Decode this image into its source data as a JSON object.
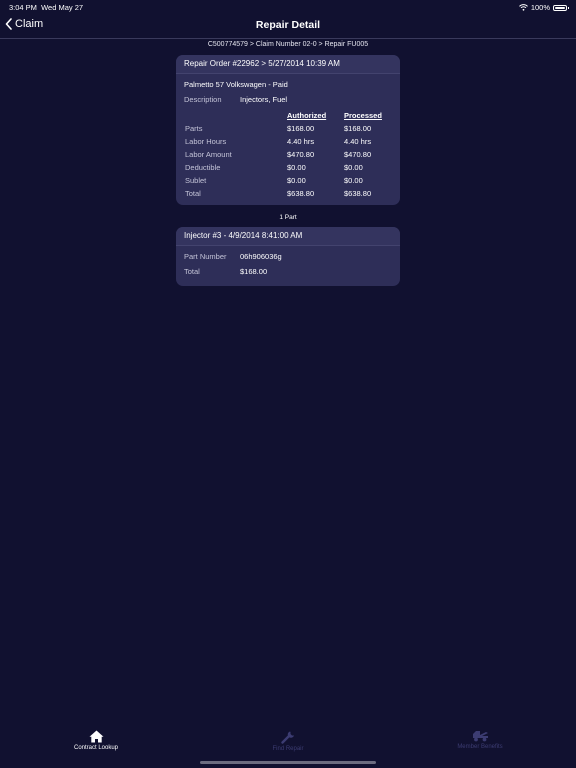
{
  "status_bar": {
    "time": "3:04 PM",
    "date": "Wed May 27",
    "battery": "100%",
    "wifi_icon": "wifi-icon",
    "battery_icon": "battery-icon"
  },
  "nav": {
    "back_label": "Claim",
    "back_icon": "chevron-left-icon",
    "title": "Repair Detail"
  },
  "breadcrumb": "C500774579 > Claim Number 02-0 > Repair FU005",
  "repair_order": {
    "header": "Repair Order #22962 > 5/27/2014 10:39 AM",
    "vehicle": "Palmetto 57 Volkswagen - Paid",
    "description_label": "Description",
    "description_value": "Injectors, Fuel",
    "columns": {
      "authorized": "Authorized",
      "processed": "Processed"
    },
    "rows": [
      {
        "label": "Parts",
        "authorized": "$168.00",
        "processed": "$168.00"
      },
      {
        "label": "Labor Hours",
        "authorized": "4.40 hrs",
        "processed": "4.40 hrs"
      },
      {
        "label": "Labor Amount",
        "authorized": "$470.80",
        "processed": "$470.80"
      },
      {
        "label": "Deductible",
        "authorized": "$0.00",
        "processed": "$0.00"
      },
      {
        "label": "Sublet",
        "authorized": "$0.00",
        "processed": "$0.00"
      },
      {
        "label": "Total",
        "authorized": "$638.80",
        "processed": "$638.80"
      }
    ]
  },
  "parts_count": "1 Part",
  "part": {
    "header": "Injector #3 - 4/9/2014 8:41:00 AM",
    "part_number_label": "Part Number",
    "part_number_value": "06h906036g",
    "total_label": "Total",
    "total_value": "$168.00"
  },
  "tabs": [
    {
      "label": "Contract Lookup",
      "icon": "home-icon",
      "active": true
    },
    {
      "label": "Find Repair",
      "icon": "wrench-icon",
      "active": false
    },
    {
      "label": "Member Benefits",
      "icon": "tow-truck-icon",
      "active": false
    }
  ],
  "colors": {
    "background": "#111130",
    "card": "#2e2e58",
    "inactive_tab": "#3c3c72"
  }
}
